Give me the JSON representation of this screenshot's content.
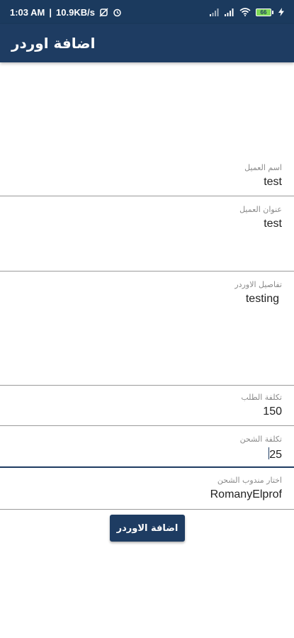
{
  "status_bar": {
    "time": "1:03 AM",
    "network_speed": "10.9KB/s",
    "battery_level": "66",
    "icons": [
      "mute-icon",
      "alarm-icon",
      "signal-icon",
      "signal-icon",
      "wifi-icon",
      "battery-icon",
      "charging-icon"
    ]
  },
  "app_bar": {
    "title": "اضافة اوردر"
  },
  "form": {
    "customer_name": {
      "label": "اسم العميل",
      "value": "test"
    },
    "customer_address": {
      "label": "عنوان العميل",
      "value": "test"
    },
    "order_details": {
      "label": "تفاصيل الاوردر",
      "value": "testing"
    },
    "order_cost": {
      "label": "تكلفة الطلب",
      "value": "150"
    },
    "shipping_cost": {
      "label": "تكلفة الشحن",
      "value": "25"
    },
    "courier": {
      "label": "اختار مندوب الشحن",
      "value": "RomanyElprof"
    }
  },
  "submit_label": "اضافة الاوردر",
  "colors": {
    "primary": "#1e3c62",
    "status_bar": "#1b3a5e",
    "battery": "#7ed957"
  }
}
